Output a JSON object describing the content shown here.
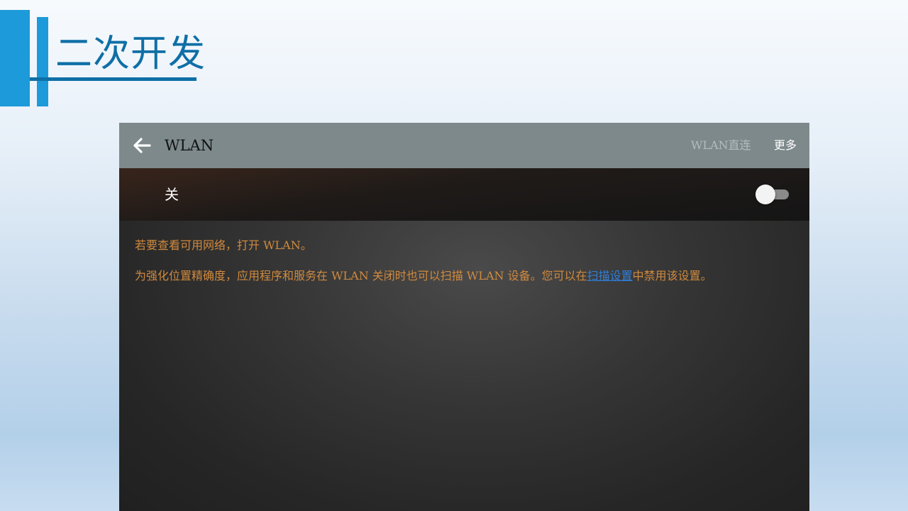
{
  "slide": {
    "title": "二次开发",
    "accent_color": "#1d9ad9",
    "title_color": "#0f6fa6"
  },
  "screen": {
    "app_bar": {
      "back_icon": "arrow-left-icon",
      "title": "WLAN",
      "actions": {
        "direct": "WLAN直连",
        "more": "更多"
      },
      "background": "#7d898b"
    },
    "wlan_switch": {
      "label": "关",
      "state": "off"
    },
    "info": {
      "line1": "若要查看可用网络，打开 WLAN。",
      "line2_before": "为强化位置精确度，应用程序和服务在 WLAN 关闭时也可以扫描 WLAN 设备。您可以在",
      "line2_link": "扫描设置",
      "line2_after": "中禁用该设置。",
      "text_color": "#d08a3e",
      "link_color": "#2f7ed8"
    }
  }
}
